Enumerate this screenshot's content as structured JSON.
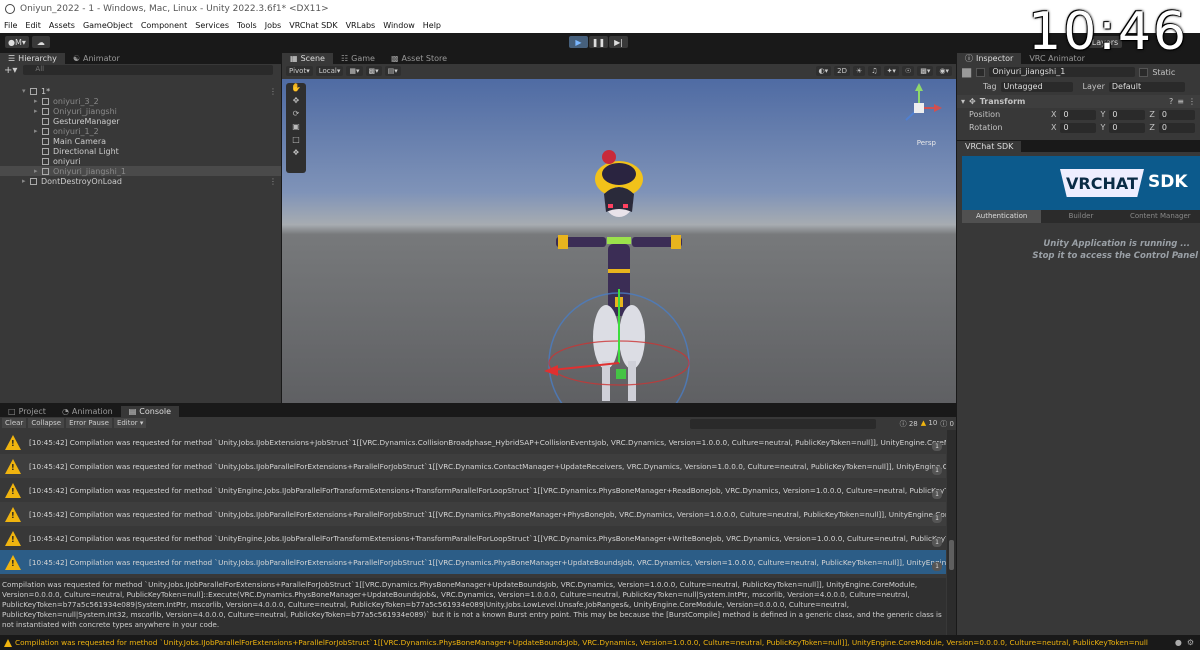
{
  "window": {
    "title": "Oniyun_2022 - 1 - Windows, Mac, Linux - Unity 2022.3.6f1* <DX11>"
  },
  "clock": "10:46",
  "menu": [
    "File",
    "Edit",
    "Assets",
    "GameObject",
    "Component",
    "Services",
    "Tools",
    "Jobs",
    "VRChat SDK",
    "VRLabs",
    "Window",
    "Help"
  ],
  "toolbar": {
    "account": "M",
    "layers": "Layers"
  },
  "hierarchy": {
    "tabs": [
      "Hierarchy",
      "Animator"
    ],
    "search_placeholder": "All",
    "rows": [
      {
        "label": "1*",
        "indent": 0,
        "dim": false
      },
      {
        "label": "oniyuri_3_2",
        "indent": 1,
        "dim": true
      },
      {
        "label": "Oniyuri_jiangshi",
        "indent": 1,
        "dim": true
      },
      {
        "label": "GestureManager",
        "indent": 1,
        "dim": false
      },
      {
        "label": "oniyuri_1_2",
        "indent": 1,
        "dim": true
      },
      {
        "label": "Main Camera",
        "indent": 1,
        "dim": false
      },
      {
        "label": "Directional Light",
        "indent": 1,
        "dim": false
      },
      {
        "label": "oniyuri",
        "indent": 1,
        "dim": false
      },
      {
        "label": "Oniyuri_jiangshi_1",
        "indent": 1,
        "dim": true
      },
      {
        "label": "DontDestroyOnLoad",
        "indent": 0,
        "dim": false
      }
    ]
  },
  "scene": {
    "tabs": [
      "Scene",
      "Game",
      "Asset Store"
    ],
    "pivot": "Pivot",
    "space": "Local",
    "mode2d": "2D",
    "persp": "Persp"
  },
  "inspector": {
    "tabs": [
      "Inspector",
      "VRC Animator"
    ],
    "object_name": "Oniyuri_jiangshi_1",
    "static_label": "Static",
    "tag_label": "Tag",
    "tag_value": "Untagged",
    "layer_label": "Layer",
    "layer_value": "Default",
    "transform_title": "Transform",
    "position_label": "Position",
    "rotation_label": "Rotation",
    "xyz": [
      "X",
      "Y",
      "Z"
    ],
    "position": [
      "0",
      "0",
      "0"
    ],
    "rotation": [
      "0",
      "0",
      "0"
    ],
    "vrchat_sdk_label": "VRChat SDK",
    "vrc_logo": "VRCHAT",
    "vrc_sdk": "SDK",
    "vrc_tabs": [
      "Authentication",
      "Builder",
      "Content Manager"
    ],
    "vrc_msg_1": "Unity Application is running ...",
    "vrc_msg_2": "Stop it to access the Control Panel"
  },
  "console": {
    "tabs": [
      "Project",
      "Animation",
      "Console"
    ],
    "tools": [
      "Clear",
      "Collapse",
      "Error Pause",
      "Editor"
    ],
    "counts": {
      "log": "28",
      "warn": "10",
      "error": "0"
    },
    "entries": [
      {
        "text": "[10:45:42] Compilation was requested for method `Unity.Jobs.IJobExtensions+JobStruct`1[[VRC.Dynamics.CollisionBroadphase_HybridSAP+CollisionEventsJob, VRC.Dynamics, Version=1.0.0.0, Culture=neutral, PublicKeyToken=null]], UnityEngine.CoreModule,",
        "count": "1"
      },
      {
        "text": "[10:45:42] Compilation was requested for method `Unity.Jobs.IJobParallelForExtensions+ParallelForJobStruct`1[[VRC.Dynamics.ContactManager+UpdateReceivers, VRC.Dynamics, Version=1.0.0.0, Culture=neutral, PublicKeyToken=null]], UnityEngine.CoreModule,",
        "count": "1"
      },
      {
        "text": "[10:45:42] Compilation was requested for method `UnityEngine.Jobs.IJobParallelForTransformExtensions+TransformParallelForLoopStruct`1[[VRC.Dynamics.PhysBoneManager+ReadBoneJob, VRC.Dynamics, Version=1.0.0.0, Culture=neutral, PublicKeyToken=",
        "count": "1"
      },
      {
        "text": "[10:45:42] Compilation was requested for method `Unity.Jobs.IJobParallelForExtensions+ParallelForJobStruct`1[[VRC.Dynamics.PhysBoneManager+PhysBoneJob, VRC.Dynamics, Version=1.0.0.0, Culture=neutral, PublicKeyToken=null]], UnityEngine.CoreModu",
        "count": "1"
      },
      {
        "text": "[10:45:42] Compilation was requested for method `UnityEngine.Jobs.IJobParallelForTransformExtensions+TransformParallelForLoopStruct`1[[VRC.Dynamics.PhysBoneManager+WriteBoneJob, VRC.Dynamics, Version=1.0.0.0, Culture=neutral, PublicKeyToken=",
        "count": "1"
      },
      {
        "text": "[10:45:42] Compilation was requested for method `Unity.Jobs.IJobParallelForExtensions+ParallelForJobStruct`1[[VRC.Dynamics.PhysBoneManager+UpdateBoundsJob, VRC.Dynamics, Version=1.0.0.0, Culture=neutral, PublicKeyToken=null]], UnityEngine.CoreMo",
        "count": "1"
      }
    ],
    "detail": "Compilation was requested for method `Unity.Jobs.IJobParallelForExtensions+ParallelForJobStruct`1[[VRC.Dynamics.PhysBoneManager+UpdateBoundsJob, VRC.Dynamics, Version=1.0.0.0, Culture=neutral, PublicKeyToken=null]], UnityEngine.CoreModule, Version=0.0.0.0, Culture=neutral, PublicKeyToken=null]::Execute(VRC.Dynamics.PhysBoneManager+UpdateBoundsJob&, VRC.Dynamics, Version=1.0.0.0, Culture=neutral, PublicKeyToken=null|System.IntPtr, mscorlib, Version=4.0.0.0, Culture=neutral, PublicKeyToken=b77a5c561934e089|System.IntPtr, mscorlib, Version=4.0.0.0, Culture=neutral, PublicKeyToken=b77a5c561934e089|Unity.Jobs.LowLevel.Unsafe.JobRanges&, UnityEngine.CoreModule, Version=0.0.0.0, Culture=neutral, PublicKeyToken=null|System.Int32, mscorlib, Version=4.0.0.0, Culture=neutral, PublicKeyToken=b77a5c561934e089)` but it is not a known Burst entry point. This may be because the [BurstCompile] method is defined in a generic class, and the generic class is not instantiated with concrete types anywhere in your code."
  },
  "statusbar": {
    "text": "Compilation was requested for method `Unity.Jobs.IJobParallelForExtensions+ParallelForJobStruct`1[[VRC.Dynamics.PhysBoneManager+UpdateBoundsJob, VRC.Dynamics, Version=1.0.0.0, Culture=neutral, PublicKeyToken=null]], UnityEngine.CoreModule, Version=0.0.0.0, Culture=neutral, PublicKeyToken=null"
  },
  "colors": {
    "accent": "#2c5d87",
    "warning": "#f0b40f",
    "play": "#46607c",
    "vrc_blue": "#0c5a8c"
  }
}
